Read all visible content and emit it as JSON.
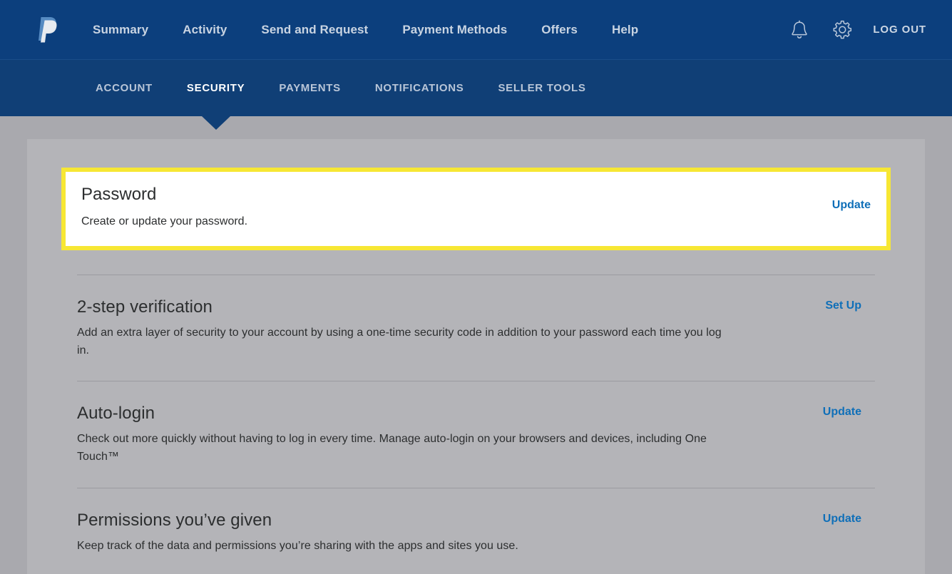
{
  "brand": {
    "logo_icon": "paypal-logo-icon",
    "logo_alt": "PayPal"
  },
  "header": {
    "nav_items": [
      {
        "label": "Summary"
      },
      {
        "label": "Activity"
      },
      {
        "label": "Send and Request"
      },
      {
        "label": "Payment Methods"
      },
      {
        "label": "Offers"
      },
      {
        "label": "Help"
      }
    ],
    "notifications_icon": "bell-icon",
    "settings_icon": "gear-icon",
    "logout_label": "LOG OUT"
  },
  "subnav": {
    "items": [
      {
        "label": "ACCOUNT",
        "active": false
      },
      {
        "label": "SECURITY",
        "active": true
      },
      {
        "label": "PAYMENTS",
        "active": false
      },
      {
        "label": "NOTIFICATIONS",
        "active": false
      },
      {
        "label": "SELLER TOOLS",
        "active": false
      }
    ],
    "active_label": "SECURITY"
  },
  "sections": {
    "password": {
      "title": "Password",
      "description": "Create or update your password.",
      "action_label": "Update",
      "highlighted": true
    },
    "two_step": {
      "title": "2-step verification",
      "description": "Add an extra layer of security to your account by using a one-time security code in addition to your password each time you log in.",
      "action_label": "Set Up"
    },
    "auto_login": {
      "title": "Auto-login",
      "description": "Check out more quickly without having to log in every time. Manage auto-login on your browsers and devices, including One Touch™",
      "action_label": "Update"
    },
    "permissions": {
      "title": "Permissions you’ve given",
      "description": "Keep track of the data and permissions you’re sharing with the apps and sites you use.",
      "action_label": "Update"
    }
  },
  "colors": {
    "header_blue": "#0c3f7d",
    "subnav_blue": "#103f76",
    "page_gray": "#a9a9ae",
    "panel_gray": "#b4b4b8",
    "link_blue": "#0f6fb8",
    "highlight_yellow": "#f7e734",
    "card_white": "#ffffff"
  }
}
